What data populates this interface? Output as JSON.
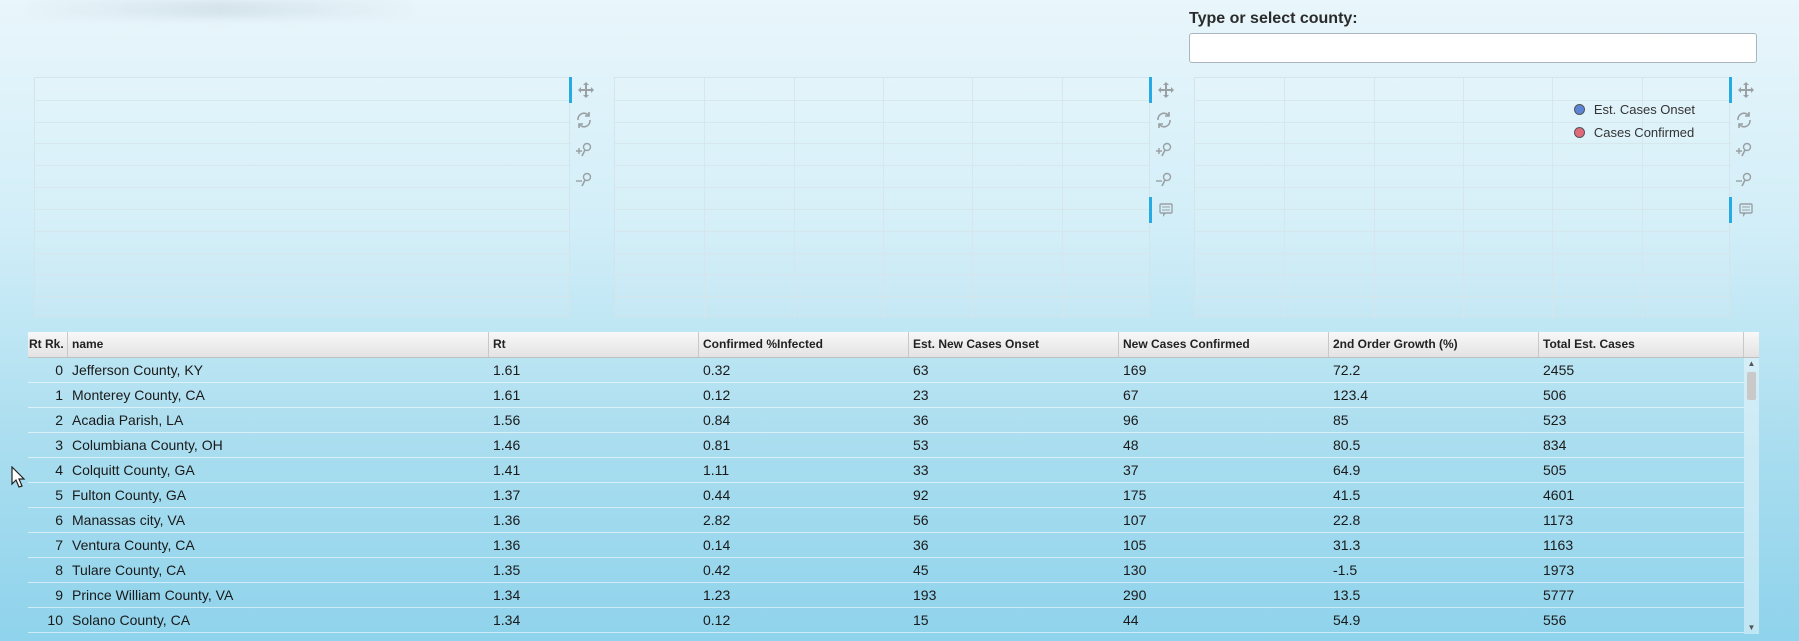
{
  "selector": {
    "label": "Type or select county:",
    "value": ""
  },
  "legend": [
    {
      "label": "Est. Cases Onset",
      "color": "#5b86d6"
    },
    {
      "label": "Cases Confirmed",
      "color": "#e0697a"
    }
  ],
  "toolbar_icons": [
    "pan-icon",
    "reset-icon",
    "zoom-in-icon",
    "zoom-out-icon",
    "hover-icon"
  ],
  "accent_color": "#26aae1",
  "table": {
    "columns": [
      "Rt Rk.",
      "name",
      "Rt",
      "Confirmed %Infected",
      "Est. New Cases Onset",
      "New Cases Confirmed",
      "2nd Order Growth (%)",
      "Total Est. Cases"
    ],
    "rows": [
      [
        "0",
        "Jefferson County, KY",
        "1.61",
        "0.32",
        "63",
        "169",
        "72.2",
        "2455"
      ],
      [
        "1",
        "Monterey County, CA",
        "1.61",
        "0.12",
        "23",
        "67",
        "123.4",
        "506"
      ],
      [
        "2",
        "Acadia Parish, LA",
        "1.56",
        "0.84",
        "36",
        "96",
        "85",
        "523"
      ],
      [
        "3",
        "Columbiana County, OH",
        "1.46",
        "0.81",
        "53",
        "48",
        "80.5",
        "834"
      ],
      [
        "4",
        "Colquitt County, GA",
        "1.41",
        "1.11",
        "33",
        "37",
        "64.9",
        "505"
      ],
      [
        "5",
        "Fulton County, GA",
        "1.37",
        "0.44",
        "92",
        "175",
        "41.5",
        "4601"
      ],
      [
        "6",
        "Manassas city, VA",
        "1.36",
        "2.82",
        "56",
        "107",
        "22.8",
        "1173"
      ],
      [
        "7",
        "Ventura County, CA",
        "1.36",
        "0.14",
        "36",
        "105",
        "31.3",
        "1163"
      ],
      [
        "8",
        "Tulare County, CA",
        "1.35",
        "0.42",
        "45",
        "130",
        "-1.5",
        "1973"
      ],
      [
        "9",
        "Prince William County, VA",
        "1.34",
        "1.23",
        "193",
        "290",
        "13.5",
        "5777"
      ],
      [
        "10",
        "Solano County, CA",
        "1.34",
        "0.12",
        "15",
        "44",
        "54.9",
        "556"
      ]
    ]
  }
}
